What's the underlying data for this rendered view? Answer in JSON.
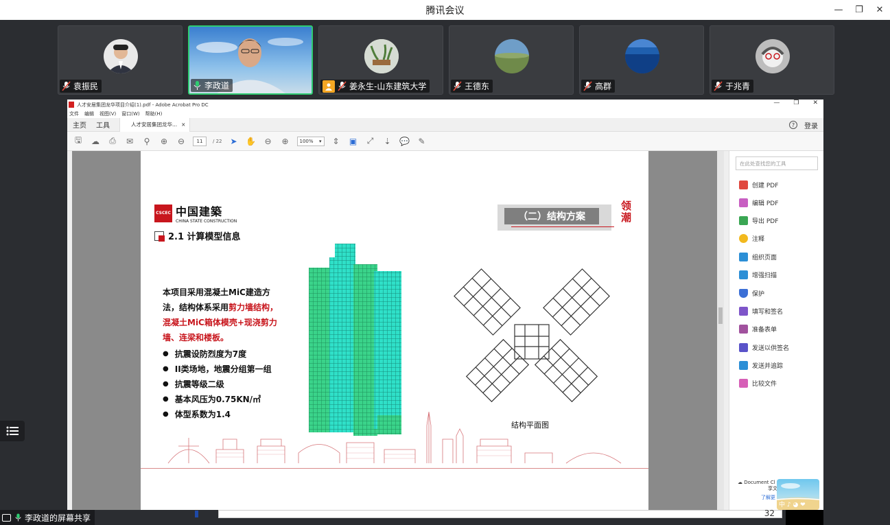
{
  "meeting": {
    "title": "腾讯会议"
  },
  "window_controls": {
    "minimize": "—",
    "restore": "❐",
    "close": "✕"
  },
  "participants": [
    {
      "name": "袁振民"
    },
    {
      "name": "李政道",
      "speaking": true
    },
    {
      "name": "姜永生-山东建筑大学",
      "host": true
    },
    {
      "name": "王德东"
    },
    {
      "name": "高群"
    },
    {
      "name": "于兆青"
    }
  ],
  "acrobat": {
    "title": "人才安居集团龙华项目介绍(1).pdf - Adobe Acrobat Pro DC",
    "menu": [
      "文件",
      "编辑",
      "视图(V)",
      "窗口(W)",
      "帮助(H)"
    ],
    "tabs": {
      "home": "主页",
      "tools": "工具",
      "doc": "人才安居集团龙华...",
      "doc_close": "×",
      "login": "登录",
      "help": "?"
    },
    "page_current": "11",
    "page_total": "/ 22",
    "zoom": "100%",
    "tools_search_placeholder": "在此处查找您的工具",
    "tools": [
      {
        "label": "创建 PDF",
        "color": "#e0483e"
      },
      {
        "label": "编辑 PDF",
        "color": "#c85fc2"
      },
      {
        "label": "导出 PDF",
        "color": "#3aa653"
      },
      {
        "label": "注释",
        "color": "#f2b91e"
      },
      {
        "label": "组织页面",
        "color": "#2c8fd6"
      },
      {
        "label": "增强扫描",
        "color": "#2c8fd6"
      },
      {
        "label": "保护",
        "color": "#3b6fd6"
      },
      {
        "label": "填写和签名",
        "color": "#7e55c9"
      },
      {
        "label": "准备表单",
        "color": "#a1529e"
      },
      {
        "label": "发送以供签名",
        "color": "#5a53c9"
      },
      {
        "label": "发送并追踪",
        "color": "#2c8fd6"
      },
      {
        "label": "比较文件",
        "color": "#d65fb7"
      }
    ],
    "doc_cloud": "Document Cl",
    "doc_cloud_sub": "享文",
    "doc_cloud_link": "了解更"
  },
  "slide": {
    "logo_cn": "中国建築",
    "logo_en": "CHINA STATE CONSTRUCTION",
    "logo_mark": "CSCEC",
    "section": "（二）结构方案",
    "calligraphy": "领潮",
    "title": "2.1 计算模型信息",
    "desc_a": "本项目采用混凝土MiC建造方法，结构体系采用",
    "desc_red": "剪力墙结构，混凝土MiC箱体模壳+现浇剪力墙、连梁和楼板。",
    "bullets": [
      "抗震设防烈度为7度",
      "II类场地，地震分组第一组",
      "抗震等级二级",
      "基本风压为0.75KN/㎡",
      "体型系数为1.4"
    ],
    "plan_caption": "结构平面图"
  },
  "ad": {
    "label": "中 ♪ ◕ ❤"
  },
  "share_indicator": "李政道的屏幕共享",
  "bottom_peek": "32",
  "colors": {
    "brand_red": "#c8161d",
    "speaking_green": "#2ecc71",
    "meeting_bg": "#2b2d31"
  }
}
